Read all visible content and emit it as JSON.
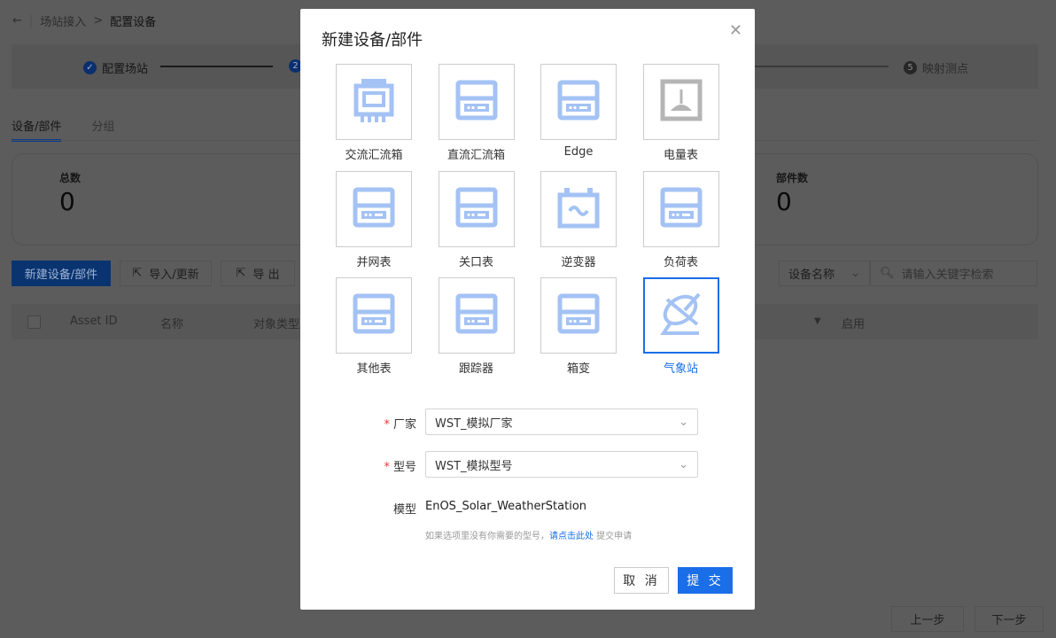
{
  "breadcrumb": {
    "parent": "场站接入",
    "separator": ">",
    "current": "配置设备"
  },
  "steps": [
    {
      "label": "配置场站",
      "state": "done"
    },
    {
      "number": "2",
      "state": "active"
    },
    {
      "number": "5",
      "label": "映射测点",
      "state": "todo"
    }
  ],
  "tabs": [
    {
      "label": "设备/部件",
      "active": true
    },
    {
      "label": "分组",
      "active": false
    }
  ],
  "stats": [
    {
      "label": "总数",
      "value": "0"
    },
    {
      "label": "部件数",
      "value": "0"
    }
  ],
  "toolbar": {
    "new": "新建设备/部件",
    "import": "导入/更新",
    "export": "导 出",
    "filter_field": "设备名称",
    "search_placeholder": "请输入关键字检索"
  },
  "table": {
    "columns": [
      "Asset ID",
      "名称",
      "对象类型",
      "启用"
    ]
  },
  "footer": {
    "prev": "上一步",
    "next": "下一步"
  },
  "modal": {
    "title": "新建设备/部件",
    "types": [
      {
        "label": "交流汇流箱",
        "icon": "ac-combiner-icon"
      },
      {
        "label": "直流汇流箱",
        "icon": "device-icon"
      },
      {
        "label": "Edge",
        "icon": "device-icon"
      },
      {
        "label": "电量表",
        "icon": "meter-icon"
      },
      {
        "label": "并网表",
        "icon": "device-icon"
      },
      {
        "label": "关口表",
        "icon": "device-icon"
      },
      {
        "label": "逆变器",
        "icon": "inverter-icon"
      },
      {
        "label": "负荷表",
        "icon": "device-icon"
      },
      {
        "label": "其他表",
        "icon": "device-icon"
      },
      {
        "label": "跟踪器",
        "icon": "device-icon"
      },
      {
        "label": "箱变",
        "icon": "device-icon"
      },
      {
        "label": "气象站",
        "icon": "weather-station-icon",
        "selected": true
      }
    ],
    "vendor_label": "厂家",
    "vendor_value": "WST_模拟厂家",
    "model_no_label": "型号",
    "model_no_value": "WST_模拟型号",
    "model_label": "模型",
    "model_value": "EnOS_Solar_WeatherStation",
    "hint_prefix": "如果选项里没有你需要的型号，",
    "hint_link": "请点击此处",
    "hint_suffix": " 提交申请",
    "cancel": "取 消",
    "submit": "提 交",
    "colors": {
      "accent": "#1a6ee8",
      "icon": "#a4c2f4"
    }
  }
}
